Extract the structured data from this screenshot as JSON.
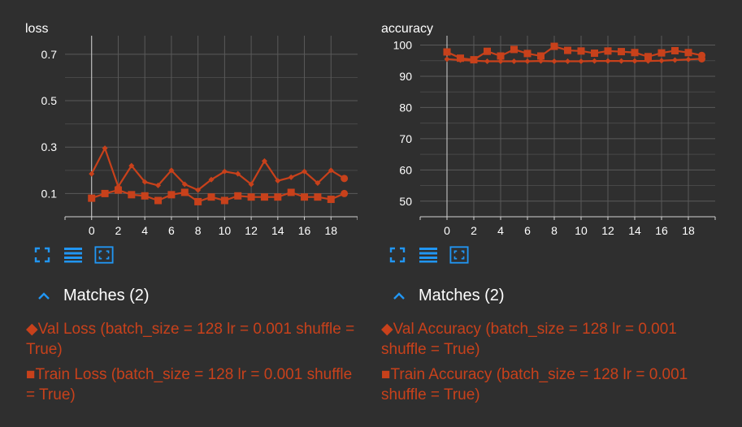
{
  "colors": {
    "series": "#c8411b",
    "accent": "#2196f3",
    "background": "#2f2f2f",
    "text": "#ffffff"
  },
  "toolbar_icons": [
    "fullscreen-icon",
    "toggle-y-log-icon",
    "fit-domain-icon"
  ],
  "chart_data": [
    {
      "type": "line",
      "title": "loss",
      "x_ticks": [
        "0",
        "2",
        "4",
        "6",
        "8",
        "10",
        "12",
        "14",
        "16",
        "18"
      ],
      "y_ticks": [
        "0.1",
        "0.3",
        "0.5",
        "0.7"
      ],
      "xlim": [
        -2,
        20
      ],
      "ylim": [
        0.0,
        0.78
      ],
      "grid": true,
      "series": [
        {
          "name": "Val Loss (batch_size = 128 lr = 0.001 shuffle = True)",
          "marker": "diamond",
          "symbol": "◆",
          "x": [
            0,
            1,
            2,
            3,
            4,
            5,
            6,
            7,
            8,
            9,
            10,
            11,
            12,
            13,
            14,
            15,
            16,
            17,
            18,
            19
          ],
          "values": [
            0.185,
            0.295,
            0.13,
            0.22,
            0.15,
            0.135,
            0.2,
            0.14,
            0.115,
            0.16,
            0.195,
            0.185,
            0.14,
            0.24,
            0.155,
            0.17,
            0.195,
            0.145,
            0.2,
            0.165
          ]
        },
        {
          "name": "Train Loss (batch_size = 128 lr = 0.001 shuffle = True)",
          "marker": "square",
          "symbol": "■",
          "x": [
            0,
            1,
            2,
            3,
            4,
            5,
            6,
            7,
            8,
            9,
            10,
            11,
            12,
            13,
            14,
            15,
            16,
            17,
            18,
            19
          ],
          "values": [
            0.08,
            0.1,
            0.115,
            0.095,
            0.09,
            0.07,
            0.095,
            0.105,
            0.065,
            0.085,
            0.07,
            0.09,
            0.085,
            0.085,
            0.085,
            0.105,
            0.085,
            0.085,
            0.075,
            0.1
          ]
        }
      ]
    },
    {
      "type": "line",
      "title": "accuracy",
      "x_ticks": [
        "0",
        "2",
        "4",
        "6",
        "8",
        "10",
        "12",
        "14",
        "16",
        "18"
      ],
      "y_ticks": [
        "50",
        "60",
        "70",
        "80",
        "90",
        "100"
      ],
      "xlim": [
        -2,
        20
      ],
      "ylim": [
        45,
        103
      ],
      "grid": true,
      "series": [
        {
          "name": "Val Accuracy (batch_size = 128 lr = 0.001 shuffle = True)",
          "marker": "diamond",
          "symbol": "◆",
          "x": [
            0,
            1,
            2,
            3,
            4,
            5,
            6,
            7,
            8,
            9,
            10,
            11,
            12,
            13,
            14,
            15,
            16,
            17,
            18,
            19
          ],
          "values": [
            95.5,
            95.2,
            95.0,
            94.8,
            94.8,
            94.8,
            94.8,
            94.9,
            94.8,
            94.8,
            94.8,
            94.9,
            94.9,
            94.9,
            94.9,
            94.9,
            95.0,
            95.2,
            95.4,
            95.6
          ]
        },
        {
          "name": "Train Accuracy (batch_size = 128 lr = 0.001 shuffle = True)",
          "marker": "square",
          "symbol": "■",
          "x": [
            0,
            1,
            2,
            3,
            4,
            5,
            6,
            7,
            8,
            9,
            10,
            11,
            12,
            13,
            14,
            15,
            16,
            17,
            18,
            19
          ],
          "values": [
            97.8,
            95.8,
            95.3,
            98.0,
            96.5,
            98.6,
            97.3,
            96.5,
            99.6,
            98.3,
            98.1,
            97.4,
            98.1,
            97.9,
            97.6,
            96.3,
            97.5,
            98.2,
            97.6,
            96.7
          ]
        }
      ]
    }
  ],
  "panels": [
    {
      "matches_label": "Matches (2)",
      "legend": [
        {
          "symbol": "◆",
          "text": "Val Loss (batch_size = 128 lr = 0.001 shuffle = True)"
        },
        {
          "symbol": "■",
          "text": "Train Loss (batch_size = 128 lr = 0.001 shuffle = True)"
        }
      ]
    },
    {
      "matches_label": "Matches (2)",
      "legend": [
        {
          "symbol": "◆",
          "text": "Val Accuracy (batch_size = 128 lr = 0.001 shuffle = True)"
        },
        {
          "symbol": "■",
          "text": "Train Accuracy (batch_size = 128 lr = 0.001 shuffle = True)"
        }
      ]
    }
  ]
}
